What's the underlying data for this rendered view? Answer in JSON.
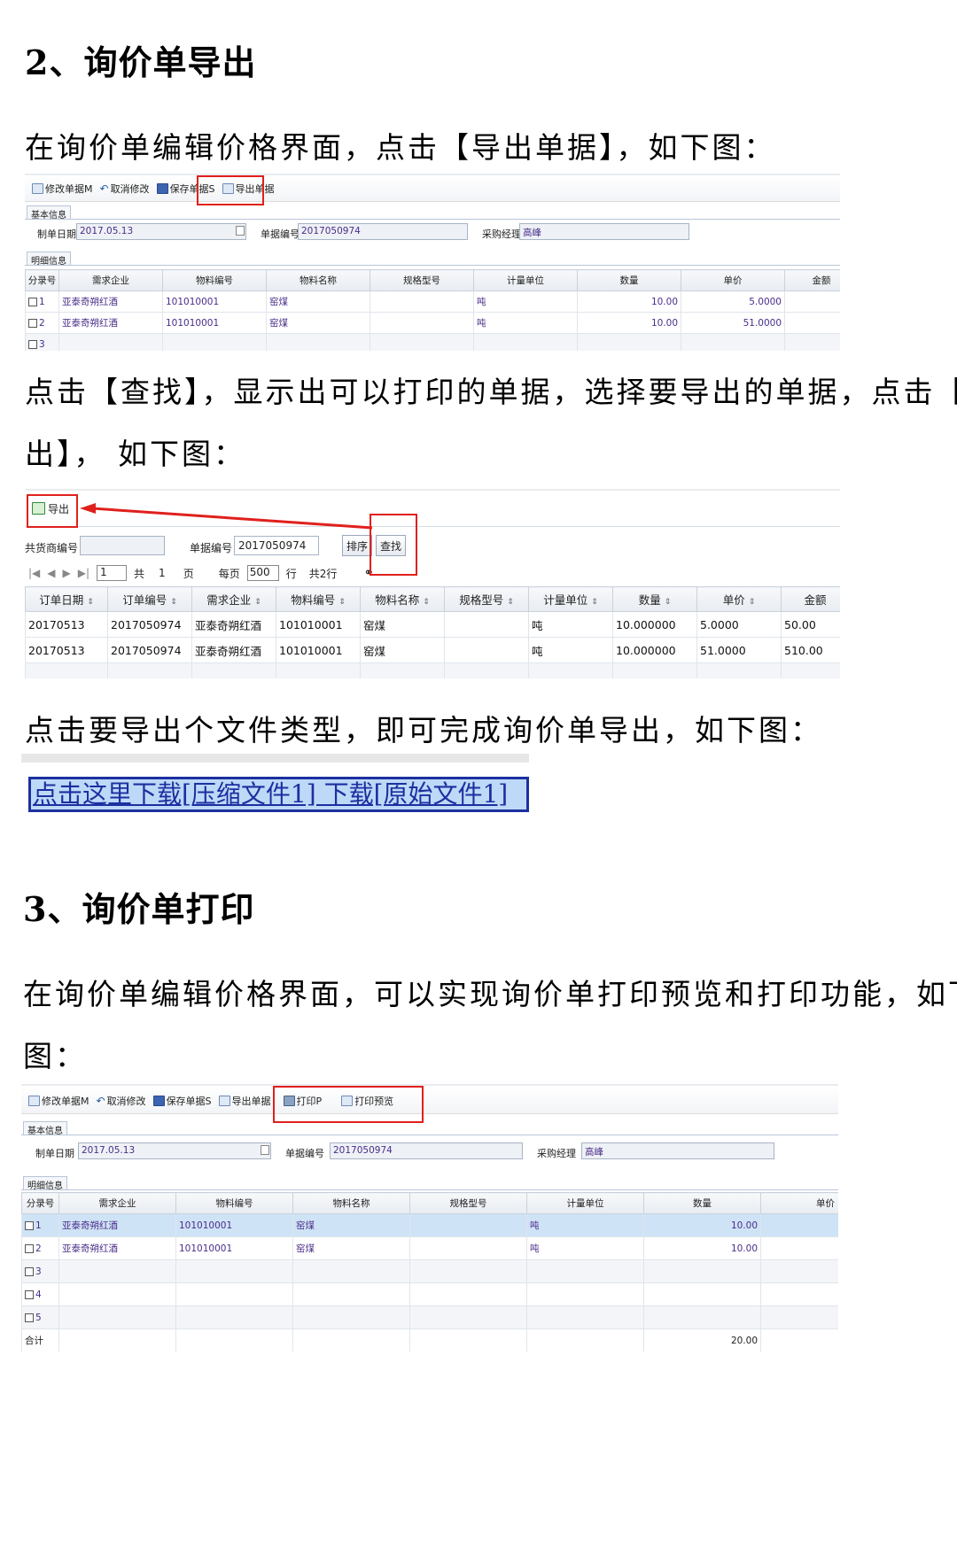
{
  "sec2": {
    "heading": "2、询价单导出",
    "intro": "在询价单编辑价格界面，点击【导出单据】，如下图：",
    "para2_line1": "点击【查找】，显示出可以打印的单据，选择要导出的单据，点击【导",
    "para2_line2": "出】， 如下图：",
    "para3": "点击要导出个文件类型，即可完成询价单导出，如下图："
  },
  "shot1": {
    "toolbar": [
      "修改单据M",
      "取消修改",
      "保存单据S",
      "导出单据"
    ],
    "basic_tab": "基本信息",
    "detail_tab": "明细信息",
    "date_label": "制单日期",
    "date_value": "2017.05.13",
    "no_label": "单据编号",
    "no_value": "2017050974",
    "mgr_label": "采购经理",
    "mgr_value": "高峰",
    "columns": [
      "分录号",
      "需求企业",
      "物料编号",
      "物料名称",
      "规格型号",
      "计量单位",
      "数量",
      "单价",
      "金额"
    ],
    "rows": [
      {
        "idx": "1",
        "company": "亚泰奇朔红酒",
        "code": "101010001",
        "name": "窑煤",
        "spec": "",
        "unit": "吨",
        "qty": "10.00",
        "price": "5.0000"
      },
      {
        "idx": "2",
        "company": "亚泰奇朔红酒",
        "code": "101010001",
        "name": "窑煤",
        "spec": "",
        "unit": "吨",
        "qty": "10.00",
        "price": "51.0000"
      },
      {
        "idx": "3",
        "company": "",
        "code": "",
        "name": "",
        "spec": "",
        "unit": "",
        "qty": "",
        "price": ""
      }
    ]
  },
  "shot2": {
    "export_label": "导出",
    "supplier_label": "共货商编号",
    "supplier_value": "",
    "no_label": "单据编号",
    "no_value": "2017050974",
    "sort_btn": "排序",
    "find_btn": "查找",
    "page_value": "1",
    "total_pages_prefix": "共",
    "total_pages": "1",
    "page_word": "页",
    "per_page_label": "每页",
    "per_page_value": "500",
    "rows_word": "行",
    "total_rows": "共2行",
    "columns": [
      "订单日期",
      "订单编号",
      "需求企业",
      "物料编号",
      "物料名称",
      "规格型号",
      "计量单位",
      "数量",
      "单价",
      "金额"
    ],
    "rows": [
      [
        "20170513",
        "2017050974",
        "亚泰奇朔红酒",
        "101010001",
        "窑煤",
        "",
        "吨",
        "10.000000",
        "5.0000",
        "50.00"
      ],
      [
        "20170513",
        "2017050974",
        "亚泰奇朔红酒",
        "101010001",
        "窑煤",
        "",
        "吨",
        "10.000000",
        "51.0000",
        "510.00"
      ]
    ]
  },
  "shot3": {
    "link_text": "点击这里下载[压缩文件1] 下载[原始文件1]"
  },
  "sec3": {
    "heading": "3、询价单打印",
    "intro_line1": "在询价单编辑价格界面，可以实现询价单打印预览和打印功能，如下",
    "intro_line2": "图："
  },
  "shot4": {
    "toolbar": [
      "修改单据M",
      "取消修改",
      "保存单据S",
      "导出单据",
      "打印P",
      "打印预览"
    ],
    "basic_tab": "基本信息",
    "detail_tab": "明细信息",
    "date_label": "制单日期",
    "date_value": "2017.05.13",
    "no_label": "单据编号",
    "no_value": "2017050974",
    "mgr_label": "采购经理",
    "mgr_value": "高峰",
    "columns": [
      "分录号",
      "需求企业",
      "物料编号",
      "物料名称",
      "规格型号",
      "计量单位",
      "数量",
      "单价"
    ],
    "rows": [
      {
        "idx": "1",
        "company": "亚泰奇朔红酒",
        "code": "101010001",
        "name": "窑煤",
        "unit": "吨",
        "qty": "10.00"
      },
      {
        "idx": "2",
        "company": "亚泰奇朔红酒",
        "code": "101010001",
        "name": "窑煤",
        "unit": "吨",
        "qty": "10.00"
      },
      {
        "idx": "3",
        "company": "",
        "code": "",
        "name": "",
        "unit": "",
        "qty": ""
      },
      {
        "idx": "4",
        "company": "",
        "code": "",
        "name": "",
        "unit": "",
        "qty": ""
      },
      {
        "idx": "5",
        "company": "",
        "code": "",
        "name": "",
        "unit": "",
        "qty": ""
      }
    ],
    "total_label": "合计",
    "total_qty": "20.00"
  }
}
